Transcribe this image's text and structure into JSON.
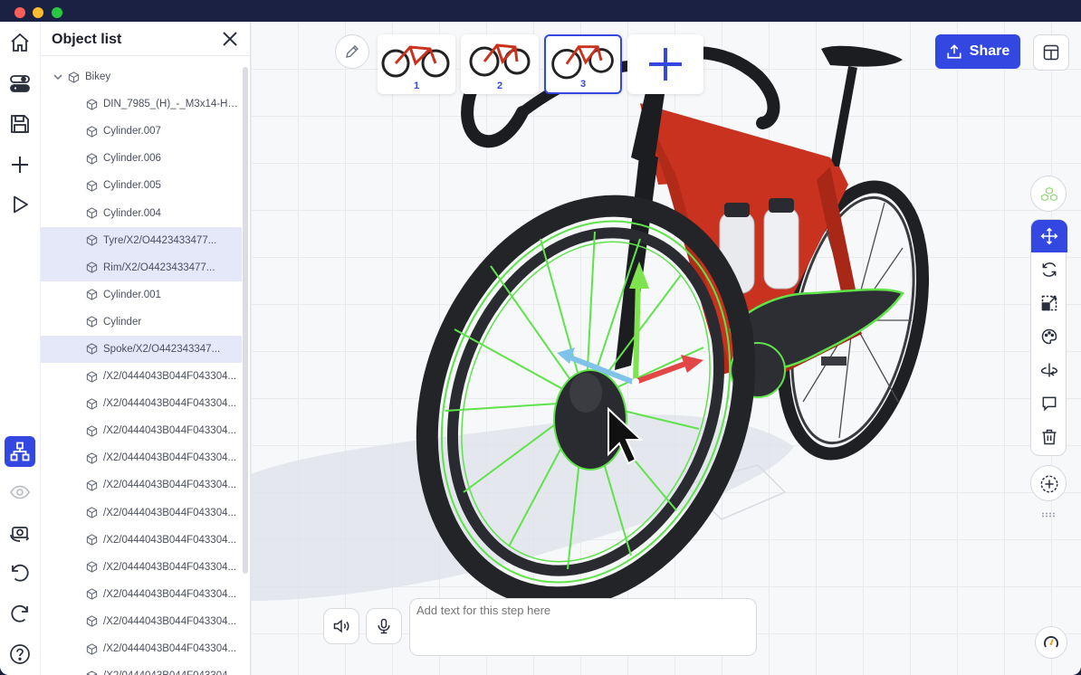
{
  "window": {
    "traffic_lights": [
      "close",
      "minimize",
      "zoom"
    ]
  },
  "toolbar": {
    "items": [
      {
        "name": "home-icon",
        "active": false
      },
      {
        "name": "toggle-icon",
        "active": false
      },
      {
        "name": "save-icon",
        "active": false
      },
      {
        "name": "add-icon",
        "active": false
      },
      {
        "name": "play-icon",
        "active": false
      },
      {
        "name": "hierarchy-icon",
        "active": true
      },
      {
        "name": "hide-eye-icon",
        "active": false
      },
      {
        "name": "camera-rotate-icon",
        "active": false
      },
      {
        "name": "undo-icon",
        "active": false
      },
      {
        "name": "redo-icon",
        "active": false
      },
      {
        "name": "help-icon",
        "active": false
      }
    ]
  },
  "object_list": {
    "title": "Object list",
    "root": "Bikey",
    "items": [
      {
        "label": "DIN_7985_(H)_-_M3x14-H_...",
        "selected": false
      },
      {
        "label": "Cylinder.007",
        "selected": false
      },
      {
        "label": "Cylinder.006",
        "selected": false
      },
      {
        "label": "Cylinder.005",
        "selected": false
      },
      {
        "label": "Cylinder.004",
        "selected": false
      },
      {
        "label": "Tyre/X2/O4423433477...",
        "selected": true
      },
      {
        "label": "Rim/X2/O4423433477...",
        "selected": true
      },
      {
        "label": "Cylinder.001",
        "selected": false
      },
      {
        "label": "Cylinder",
        "selected": false
      },
      {
        "label": "Spoke/X2/O442343347...",
        "selected": true
      },
      {
        "label": "/X2/0444043B044F043304...",
        "selected": false
      },
      {
        "label": "/X2/0444043B044F043304...",
        "selected": false
      },
      {
        "label": "/X2/0444043B044F043304...",
        "selected": false
      },
      {
        "label": "/X2/0444043B044F043304...",
        "selected": false
      },
      {
        "label": "/X2/0444043B044F043304...",
        "selected": false
      },
      {
        "label": "/X2/0444043B044F043304...",
        "selected": false
      },
      {
        "label": "/X2/0444043B044F043304...",
        "selected": false
      },
      {
        "label": "/X2/0444043B044F043304...",
        "selected": false
      },
      {
        "label": "/X2/0444043B044F043304...",
        "selected": false
      },
      {
        "label": "/X2/0444043B044F043304...",
        "selected": false
      },
      {
        "label": "/X2/0444043B044F043304...",
        "selected": false
      },
      {
        "label": "/X2/0444043B044F043304...",
        "selected": false
      }
    ]
  },
  "steps": {
    "items": [
      {
        "number": "1",
        "active": false
      },
      {
        "number": "2",
        "active": false
      },
      {
        "number": "3",
        "active": true
      }
    ],
    "add_icon": "plus-icon"
  },
  "header": {
    "share_label": "Share",
    "share_icon": "upload-icon",
    "layout_icon": "panel-layout-icon",
    "edit_icon": "pencil-icon"
  },
  "right_tools": {
    "items": [
      "group-icon",
      "move-icon",
      "rotate-icon",
      "scale-icon",
      "palette-icon",
      "flip-icon",
      "comment-icon",
      "trash-icon",
      "add-hotspot-icon"
    ],
    "active": "move-icon"
  },
  "step_editor": {
    "placeholder": "Add text for this step here",
    "sound_icon": "speaker-icon",
    "mic_icon": "microphone-icon",
    "speed_icon": "speedometer-icon"
  },
  "colors": {
    "accent": "#3348e0",
    "selection_outline": "#5fe34b",
    "frame_red": "#c8321e",
    "selected_row": "#e5e8f8"
  }
}
